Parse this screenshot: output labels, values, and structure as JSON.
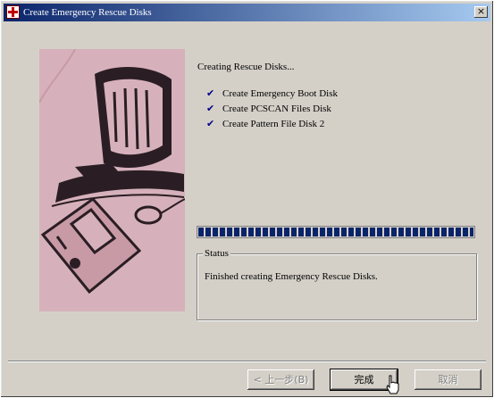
{
  "window": {
    "title": "Create Emergency Rescue Disks",
    "close_label": "×"
  },
  "main": {
    "heading": "Creating Rescue Disks...",
    "tasks": [
      {
        "label": "Create Emergency Boot Disk",
        "done": true
      },
      {
        "label": "Create PCSCAN Files Disk",
        "done": true
      },
      {
        "label": "Create Pattern File Disk 2",
        "done": true
      }
    ],
    "check_glyph": "✔",
    "progress_fraction": 1.0,
    "status_label": "Status",
    "status_text": "Finished creating Emergency Rescue Disks."
  },
  "buttons": {
    "back_label": "< 上一步(B)",
    "finish_label": "完成",
    "cancel_label": "取消"
  },
  "colors": {
    "title_start": "#0a246a",
    "title_end": "#a6caf0",
    "illustration_bg": "#d6b1bb",
    "progress": "#0a246a",
    "check": "#00008b"
  },
  "icons": {
    "title_icon": "rescue-cross-icon",
    "cursor": "hand-pointer-icon"
  }
}
